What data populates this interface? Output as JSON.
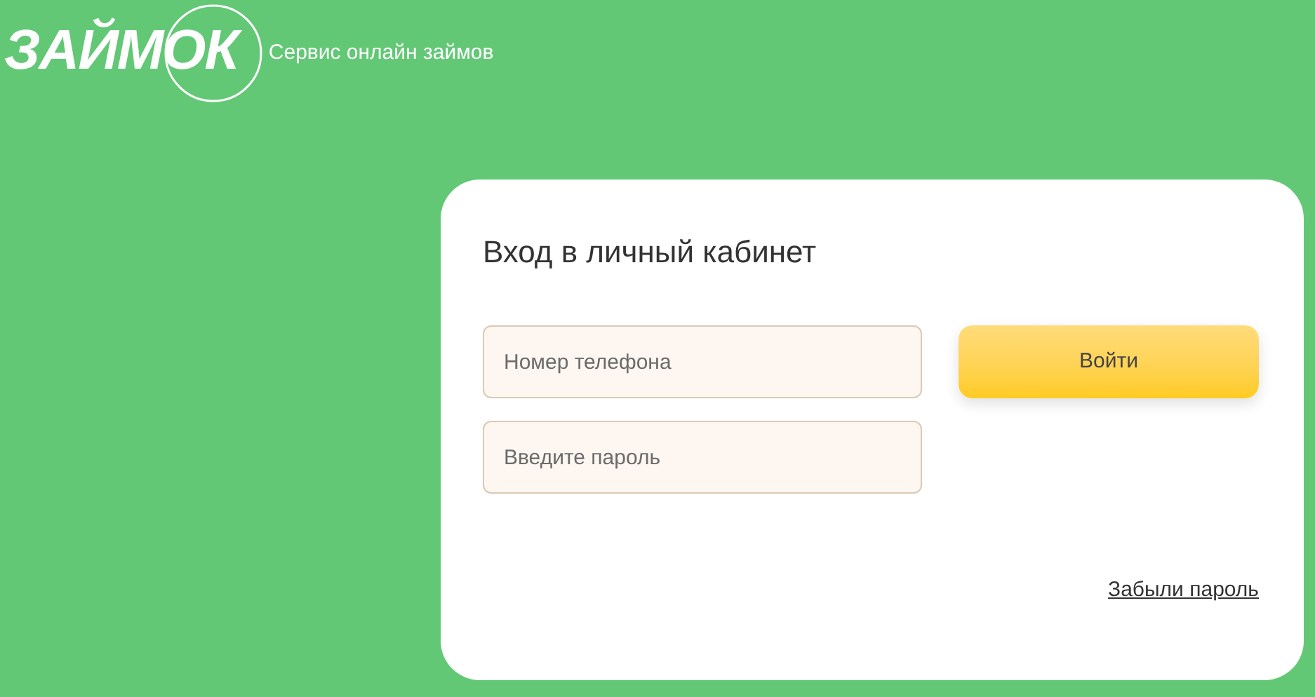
{
  "header": {
    "logo": "ЗАЙМОК",
    "tagline": "Сервис онлайн займов"
  },
  "login": {
    "title": "Вход в личный кабинет",
    "fields": [
      {
        "placeholder": "Номер телефона"
      },
      {
        "placeholder": "Введите пароль"
      }
    ],
    "submit": "Войти",
    "forgot_link": "Забыли пароль"
  }
}
